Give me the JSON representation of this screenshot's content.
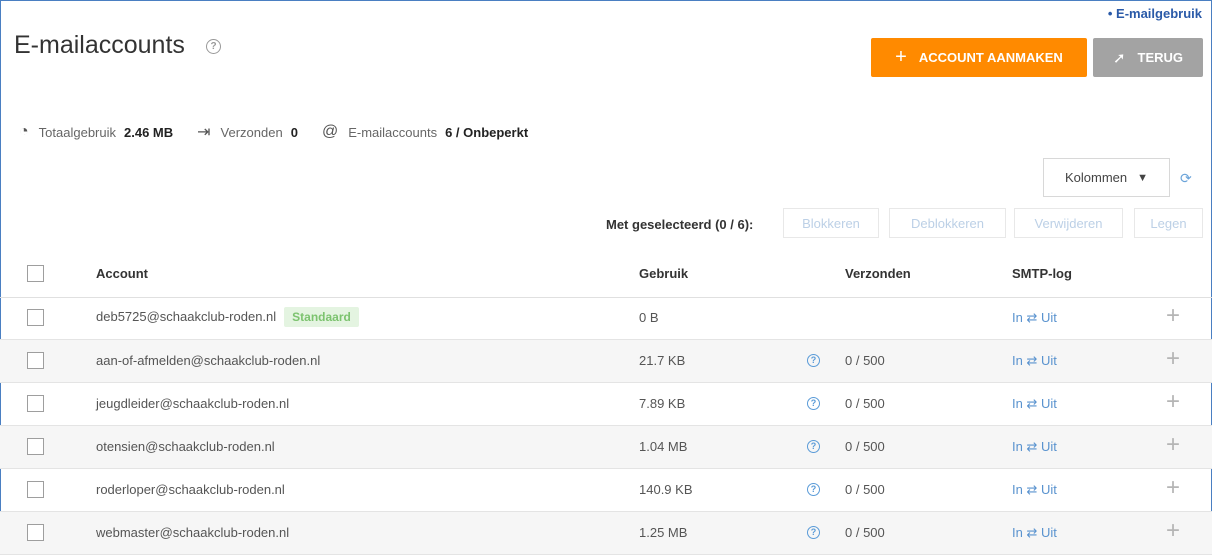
{
  "breadcrumb": "• E-mailgebruik",
  "page_title": "E-mailaccounts",
  "help_glyph": "?",
  "buttons": {
    "create": "ACCOUNT AANMAKEN",
    "back": "TERUG",
    "plus_glyph": "+",
    "arrow_glyph": "➚"
  },
  "stats": {
    "total_label": "Totaalgebruik",
    "total_value": "2.46 MB",
    "sent_label": "Verzonden",
    "sent_value": "0",
    "accounts_label": "E-mailaccounts",
    "accounts_value": "6 / Onbeperkt"
  },
  "columns_dropdown": "Kolommen",
  "selection": {
    "label": "Met geselecteerd (0 / 6):",
    "block": "Blokkeren",
    "unblock": "Deblokkeren",
    "delete": "Verwijderen",
    "empty": "Legen"
  },
  "table": {
    "headers": {
      "account": "Account",
      "usage": "Gebruik",
      "sent": "Verzonden",
      "smtp": "SMTP-log"
    },
    "rows": [
      {
        "account": "deb5725@schaakclub-roden.nl",
        "badge": "Standaard",
        "usage": "0 B",
        "sent": "",
        "smtp": "In ⇄ Uit"
      },
      {
        "account": "aan-of-afmelden@schaakclub-roden.nl",
        "usage": "21.7 KB",
        "sent": "0 / 500",
        "smtp": "In ⇄ Uit"
      },
      {
        "account": "jeugdleider@schaakclub-roden.nl",
        "usage": "7.89 KB",
        "sent": "0 / 500",
        "smtp": "In ⇄ Uit"
      },
      {
        "account": "otensien@schaakclub-roden.nl",
        "usage": "1.04 MB",
        "sent": "0 / 500",
        "smtp": "In ⇄ Uit"
      },
      {
        "account": "roderloper@schaakclub-roden.nl",
        "usage": "140.9 KB",
        "sent": "0 / 500",
        "smtp": "In ⇄ Uit"
      },
      {
        "account": "webmaster@schaakclub-roden.nl",
        "usage": "1.25 MB",
        "sent": "0 / 500",
        "smtp": "In ⇄ Uit"
      }
    ]
  },
  "colors": {
    "accent": "#ff8a00",
    "back_button": "#a3a3a3",
    "link": "#5a93cf",
    "badge_bg": "#e4f4e1",
    "badge_text": "#7cc36f"
  }
}
